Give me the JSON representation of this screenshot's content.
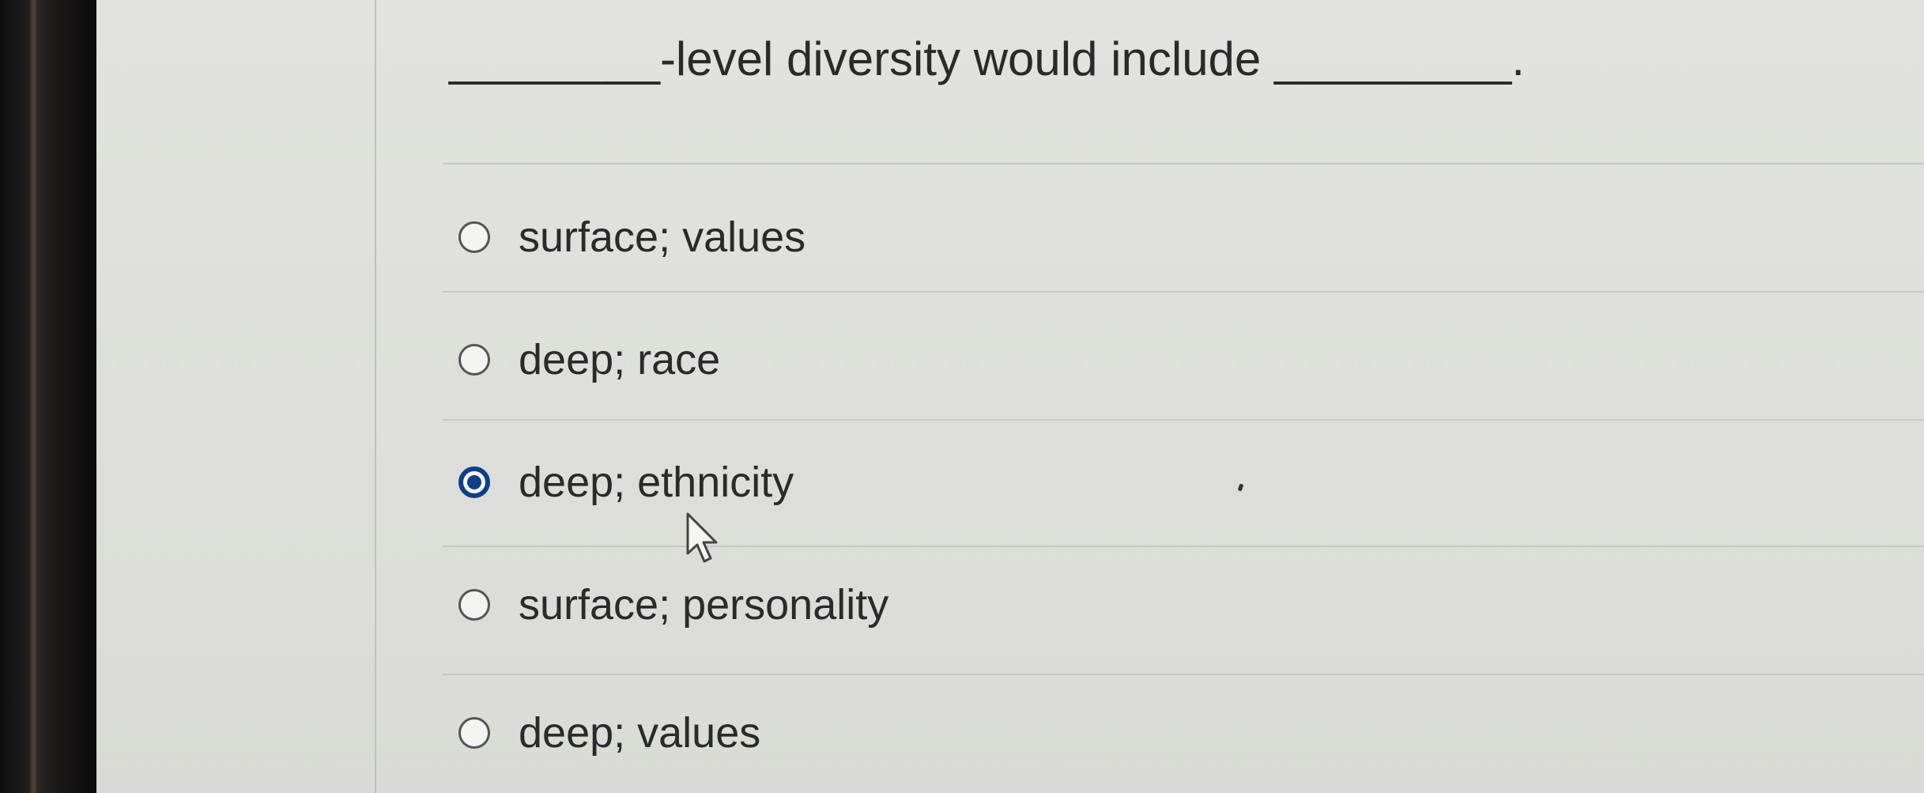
{
  "question": {
    "text": "________-level diversity would include _________."
  },
  "options": [
    {
      "label": "surface; values",
      "selected": false
    },
    {
      "label": "deep; race",
      "selected": false
    },
    {
      "label": "deep; ethnicity",
      "selected": true
    },
    {
      "label": "surface; personality",
      "selected": false
    },
    {
      "label": "deep; values",
      "selected": false
    }
  ],
  "colors": {
    "selected_radio": "#0f3f86",
    "background": "#dedfda"
  },
  "icons": {
    "cursor": "mouse-pointer-icon"
  }
}
